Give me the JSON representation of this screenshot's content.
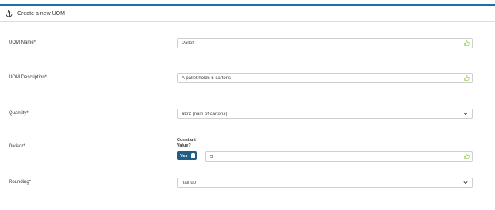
{
  "header": {
    "title": "Create a new UOM",
    "icon": "anchor-icon"
  },
  "form": {
    "uom_name": {
      "label": "UOM Name*",
      "value": "Pallet"
    },
    "uom_description": {
      "label": "UOM Description*",
      "value": "A pallet holds 5 cartons"
    },
    "quantity": {
      "label": "Quantity*",
      "value": "attr2 (num of cartons)"
    },
    "divisor": {
      "label": "Divisor*",
      "constant_label_line1": "Constant",
      "constant_label_line2": "Value?",
      "toggle_label": "Yes",
      "value": "5"
    },
    "rounding": {
      "label": "Rounding*",
      "value": "half up"
    }
  },
  "colors": {
    "accent": "#1f6fa8",
    "toggle_bg": "#1e5f86",
    "valid_icon": "#8bc34a"
  }
}
